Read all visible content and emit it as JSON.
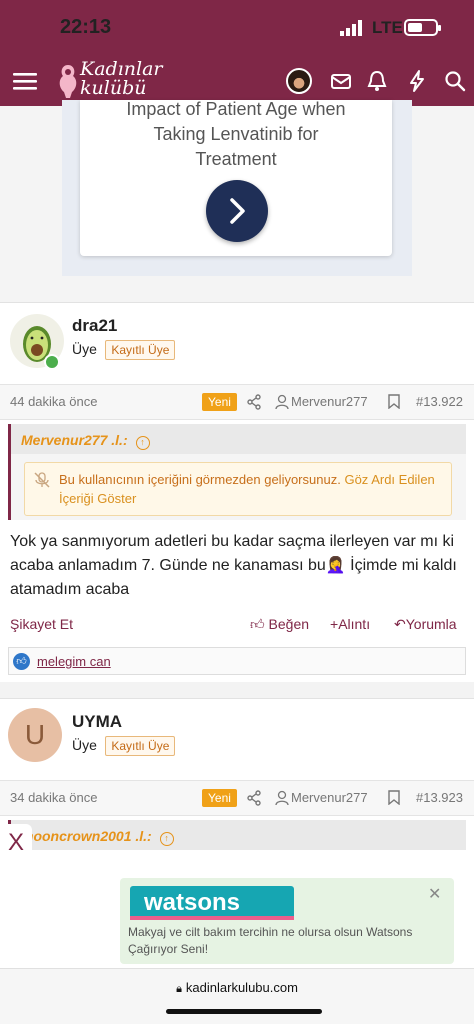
{
  "status": {
    "time": "22:13",
    "network": "LTE"
  },
  "nav": {
    "logo": "Kadınlar kulübü"
  },
  "ad": {
    "line1": "Impact of Patient Age when",
    "line2": "Taking Lenvatinib for",
    "line3": "Treatment"
  },
  "posts": [
    {
      "username": "dra21",
      "role": "Üye",
      "badge": "Kayıtlı Üye",
      "time": "44 dakika önce",
      "new_label": "Yeni",
      "quoted_user": "Mervenur277",
      "post_number": "#13.922",
      "quote_header": "Mervenur277 .l.:",
      "notice_text": "Bu kullanıcının içeriğini görmezden geliyorsunuz.",
      "notice_link": "Göz Ardı Edilen İçeriği Göster",
      "body_part1": "Yok ya sanmıyorum adetleri bu kadar saçma ilerleyen var mı ki acaba anlamadım 7. Günde ne kanaması bu",
      "body_emoji": "🤦‍♀️",
      "body_part2": " İçimde mi kaldı atamadım acaba",
      "report": "Şikayet Et",
      "like": "Beğen",
      "quote": "Alıntı",
      "reply": "Yorumla",
      "reaction_user": "melegim can"
    },
    {
      "username": "UYMA",
      "avatar_letter": "U",
      "role": "Üye",
      "badge": "Kayıtlı Üye",
      "time": "34 dakika önce",
      "new_label": "Yeni",
      "quoted_user": "Mervenur277",
      "post_number": "#13.923",
      "quote_header": "mooncrown2001 .l.:"
    }
  ],
  "bottom_ad": {
    "brand": "watsons",
    "text": "Makyaj ve cilt bakım tercihin ne olursa olsun Watsons Çağırıyor Seni!",
    "close": "✕",
    "x_label": "X"
  },
  "browser": {
    "url": "kadinlarkulubu.com"
  },
  "colors": {
    "brand": "#7f2747",
    "accent": "#f0a118",
    "watsons": "#16a6b2"
  },
  "icons": [
    "menu-icon",
    "mail-icon",
    "bell-icon",
    "bolt-icon",
    "search-icon",
    "share-icon",
    "user-icon",
    "bookmark-icon",
    "like-icon",
    "plus-icon",
    "reply-icon",
    "lock-icon"
  ]
}
